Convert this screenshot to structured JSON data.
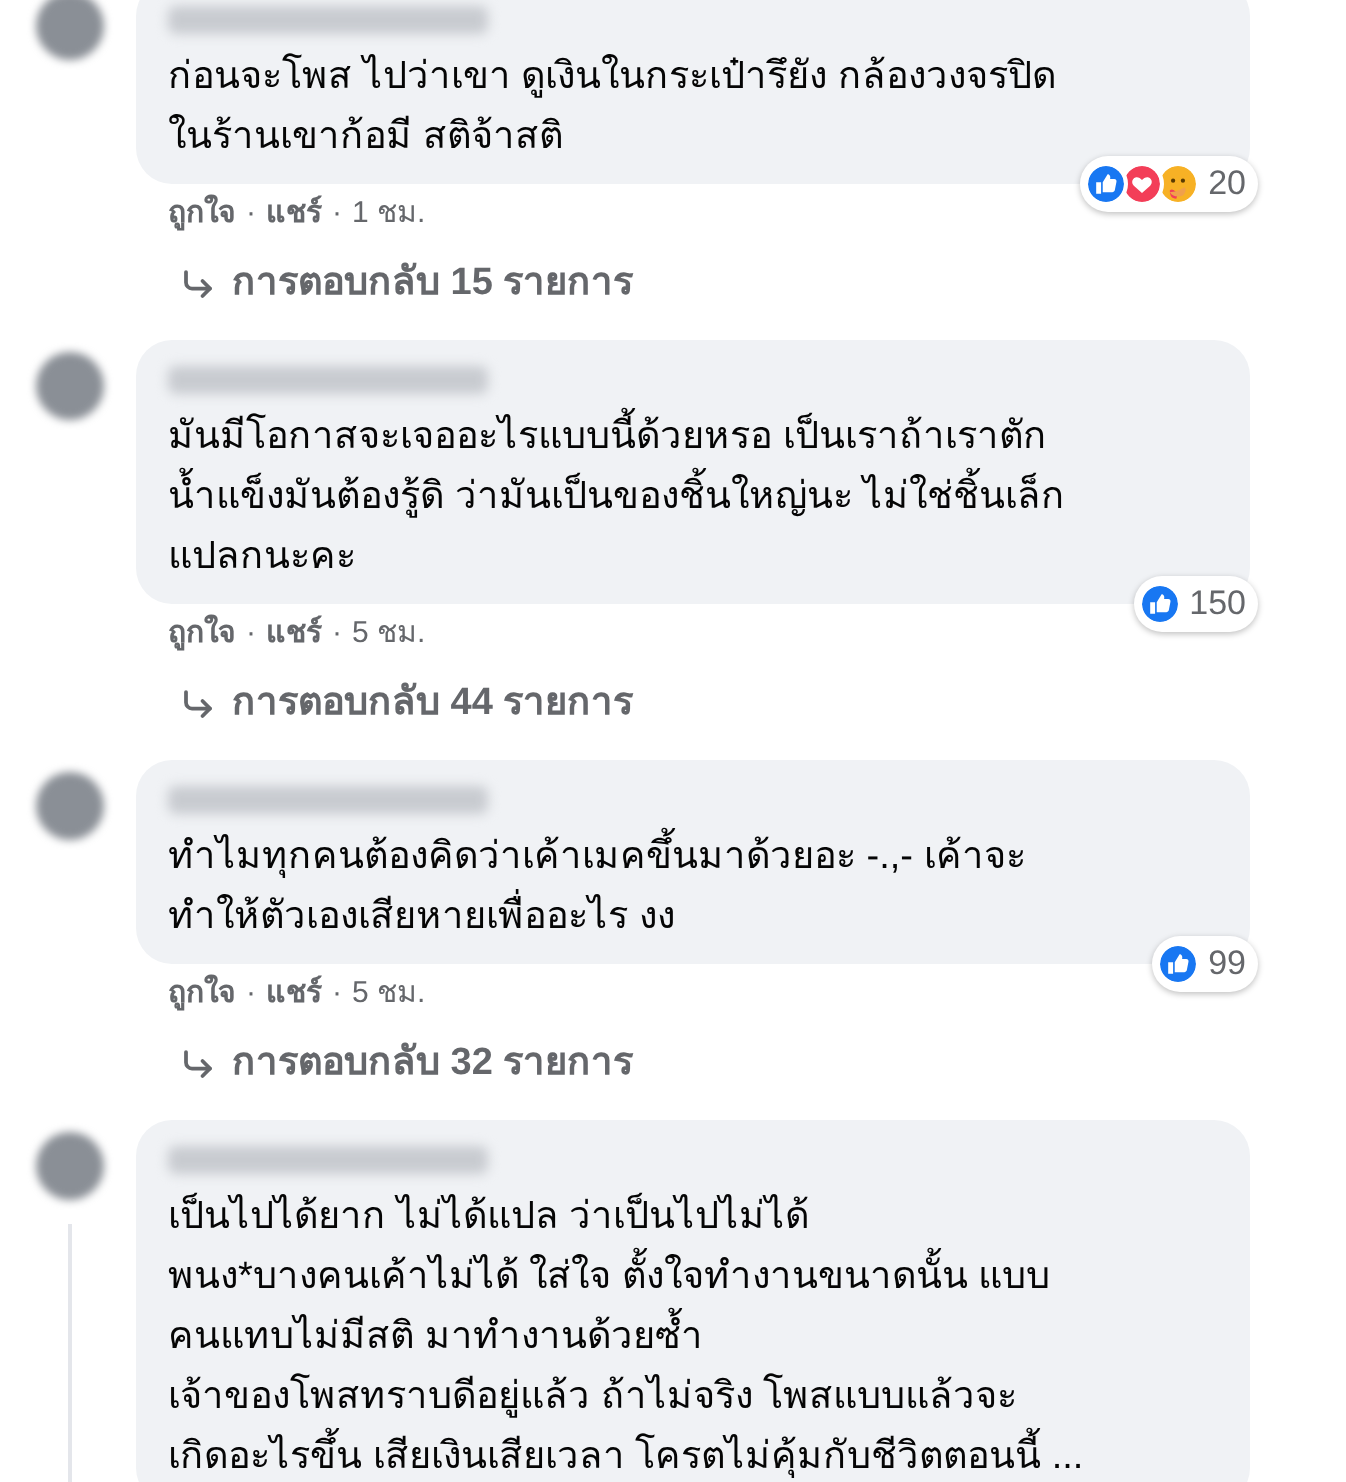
{
  "comments": [
    {
      "lines": [
        "ก่อนจะโพส ไปว่าเขา ดูเงินในกระเป๋ารึยัง กล้องวงจรปิด",
        "ในร้านเขาก้อมี สติจ้าสติ"
      ],
      "reactions": [
        {
          "kind": "like"
        },
        {
          "kind": "love"
        },
        {
          "kind": "care"
        }
      ],
      "reaction_count": "20",
      "actions": [
        {
          "kind": "link",
          "text": "ถูกใจ"
        },
        {
          "kind": "dot",
          "text": "·"
        },
        {
          "kind": "link",
          "text": "แชร์"
        },
        {
          "kind": "dot",
          "text": "·"
        },
        {
          "kind": "time",
          "text": "1 ชม."
        }
      ],
      "replies": "การตอบกลับ 15 รายการ"
    },
    {
      "lines": [
        "มันมีโอกาสจะเจออะไรแบบนี้ด้วยหรอ เป็นเราถ้าเราตัก",
        "น้ำแข็งมันต้องรู้ดิ ว่ามันเป็นของชิ้นใหญ่นะ ไม่ใช่ชิ้นเล็ก",
        "แปลกนะคะ"
      ],
      "reactions": [
        {
          "kind": "like"
        }
      ],
      "reaction_count": "150",
      "actions": [
        {
          "kind": "link",
          "text": "ถูกใจ"
        },
        {
          "kind": "dot",
          "text": "·"
        },
        {
          "kind": "link",
          "text": "แชร์"
        },
        {
          "kind": "dot",
          "text": "·"
        },
        {
          "kind": "time",
          "text": "5 ชม."
        }
      ],
      "replies": "การตอบกลับ 44 รายการ"
    },
    {
      "lines": [
        "ทำไมทุกคนต้องคิดว่าเค้าเมคขึ้นมาด้วยอะ -.,- เค้าจะ",
        "ทำให้ตัวเองเสียหายเพื่ออะไร งง"
      ],
      "reactions": [
        {
          "kind": "like"
        }
      ],
      "reaction_count": "99",
      "actions": [
        {
          "kind": "link",
          "text": "ถูกใจ"
        },
        {
          "kind": "dot",
          "text": "·"
        },
        {
          "kind": "link",
          "text": "แชร์"
        },
        {
          "kind": "dot",
          "text": "·"
        },
        {
          "kind": "time",
          "text": "5 ชม."
        }
      ],
      "replies": "การตอบกลับ 32 รายการ"
    },
    {
      "lines": [
        "เป็นไปได้ยาก ไม่ได้แปล ว่าเป็นไปไม่ได้",
        "พนง*บางคนเค้าไม่ได้ ใส่ใจ ตั้งใจทำงานขนาดนั้น แบบ",
        "คนแทบไม่มีสติ มาทำงานด้วยซ้ำ",
        "เจ้าของโพสทราบดีอยู่แล้ว ถ้าไม่จริง โพสแบบแล้วจะ",
        "เกิดอะไรขึ้น เสียเงินเสียเวลา โครตไม่คุ้มกับชีวิตตอนนี้ ..."
      ],
      "thread": true
    }
  ]
}
